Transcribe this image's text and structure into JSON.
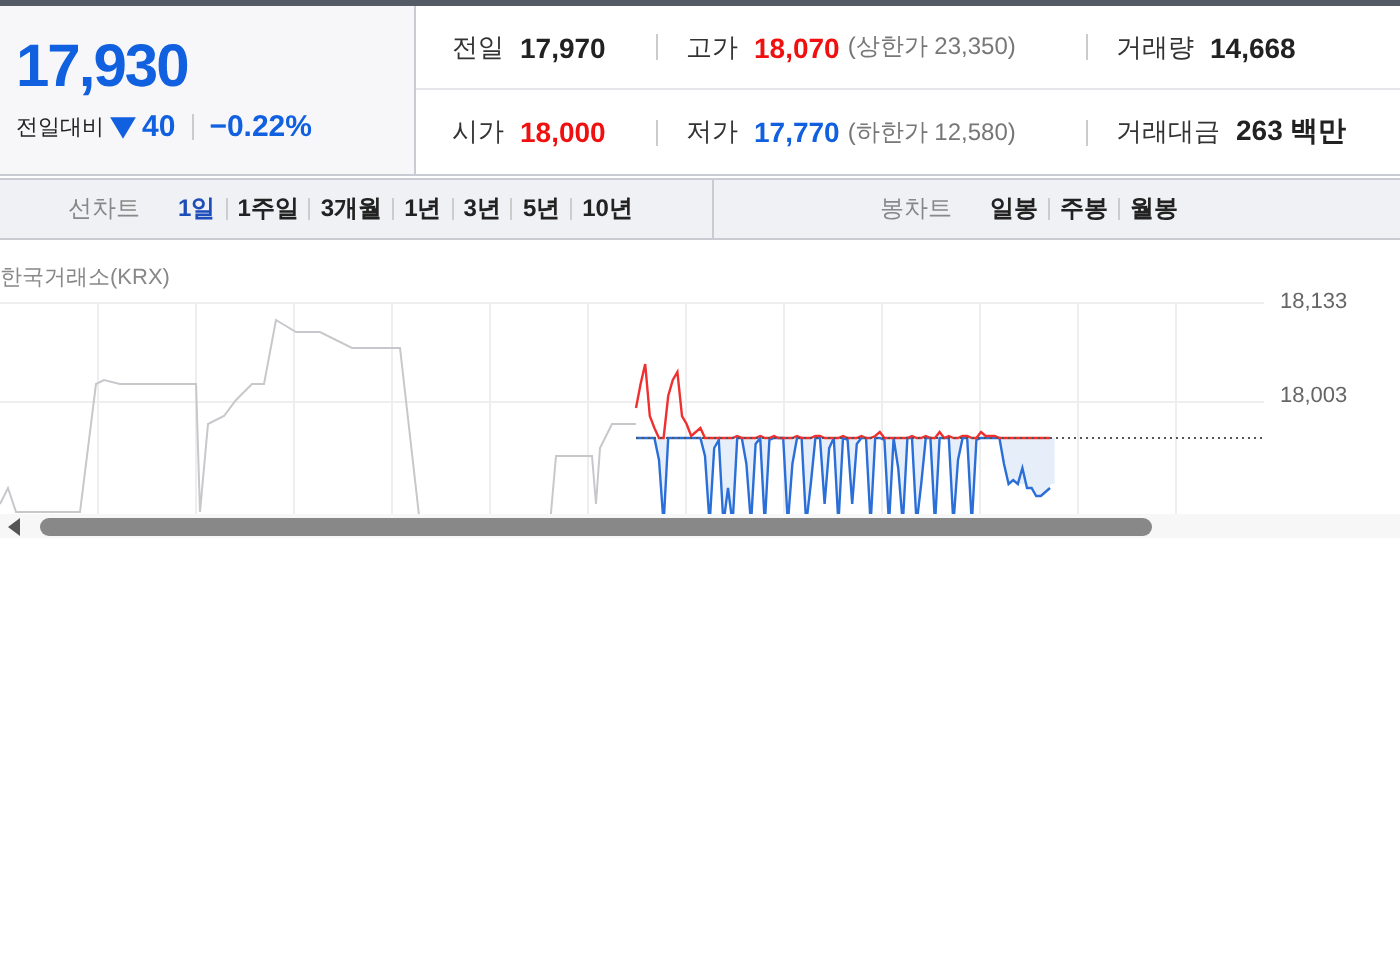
{
  "quote": {
    "price": "17,930",
    "change_label": "전일대비",
    "falling": true,
    "change": "40",
    "change_rate": "−0.22%"
  },
  "stats": [
    {
      "label": "전일",
      "value": "17,970",
      "color": "#222222"
    },
    {
      "label": "고가",
      "value": "18,070",
      "color": "#f01010",
      "limit": "(상한가 23,350)"
    },
    {
      "label": "거래량",
      "value": "14,668",
      "color": "#222222"
    },
    {
      "label": "시가",
      "value": "18,000",
      "color": "#f01010"
    },
    {
      "label": "저가",
      "value": "17,770",
      "color": "#1060e0",
      "limit": "(하한가 12,580)"
    },
    {
      "label": "거래대금",
      "value": "263 백만",
      "color": "#222222"
    }
  ],
  "line_chart": {
    "label": "선차트",
    "tabs": [
      {
        "label": "1일",
        "selected": true
      },
      {
        "label": "1주일",
        "selected": false
      },
      {
        "label": "3개월",
        "selected": false
      },
      {
        "label": "1년",
        "selected": false
      },
      {
        "label": "3년",
        "selected": false
      },
      {
        "label": "5년",
        "selected": false
      },
      {
        "label": "10년",
        "selected": false
      }
    ]
  },
  "candle_chart": {
    "label": "봉차트",
    "tabs": [
      {
        "label": "일봉",
        "selected": false
      },
      {
        "label": "주봉",
        "selected": false
      },
      {
        "label": "월봉",
        "selected": false
      }
    ]
  },
  "chart": {
    "source": "한국거래소(KRX)",
    "y_ticks": [
      "18,133",
      "18,003"
    ]
  }
}
